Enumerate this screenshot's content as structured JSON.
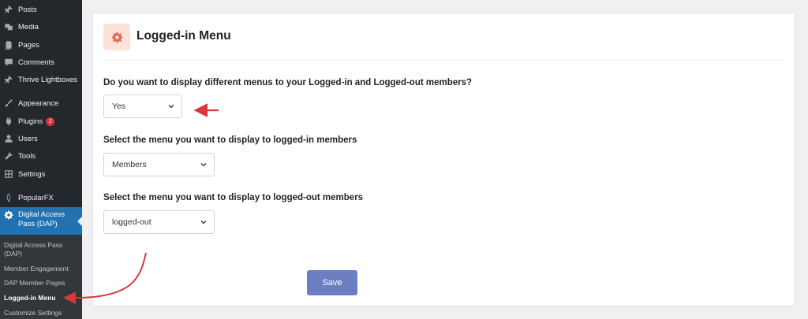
{
  "sidebar": {
    "items": [
      {
        "label": "Posts",
        "icon": "pin-icon"
      },
      {
        "label": "Media",
        "icon": "media-icon"
      },
      {
        "label": "Pages",
        "icon": "pages-icon"
      },
      {
        "label": "Comments",
        "icon": "comments-icon"
      },
      {
        "label": "Thrive Lightboxes",
        "icon": "pin-icon"
      },
      {
        "label": "Appearance",
        "icon": "brush-icon"
      },
      {
        "label": "Plugins",
        "icon": "plugin-icon",
        "badge": "2"
      },
      {
        "label": "Users",
        "icon": "user-icon"
      },
      {
        "label": "Tools",
        "icon": "wrench-icon"
      },
      {
        "label": "Settings",
        "icon": "settings-icon"
      },
      {
        "label": "PopularFX",
        "icon": "leaf-icon"
      }
    ],
    "active": {
      "label": "Digital Access Pass (DAP)",
      "icon": "gear-icon"
    },
    "submenu": [
      {
        "label": "Digital Access Pass (DAP)"
      },
      {
        "label": "Member Engagement"
      },
      {
        "label": "DAP Member Pages"
      },
      {
        "label": "Logged-in Menu"
      },
      {
        "label": "Customize Settings"
      }
    ]
  },
  "main": {
    "title": "Logged-in Menu",
    "questions": [
      {
        "label": "Do you want to display different menus to your Logged-in and Logged-out members?",
        "value": "Yes"
      },
      {
        "label": "Select the menu you want to display to logged-in members",
        "value": "Members"
      },
      {
        "label": "Select the menu you want to display to logged-out members",
        "value": "logged-out"
      }
    ],
    "save_label": "Save"
  },
  "colors": {
    "sidebar_bg": "#23282d",
    "active_bg": "#2271b1",
    "submenu_bg": "#32373c",
    "save_button": "#6c7fc1",
    "annotation_arrow": "#d9363e",
    "header_icon_bg": "#fde2dc",
    "header_icon": "#e26a4f"
  }
}
